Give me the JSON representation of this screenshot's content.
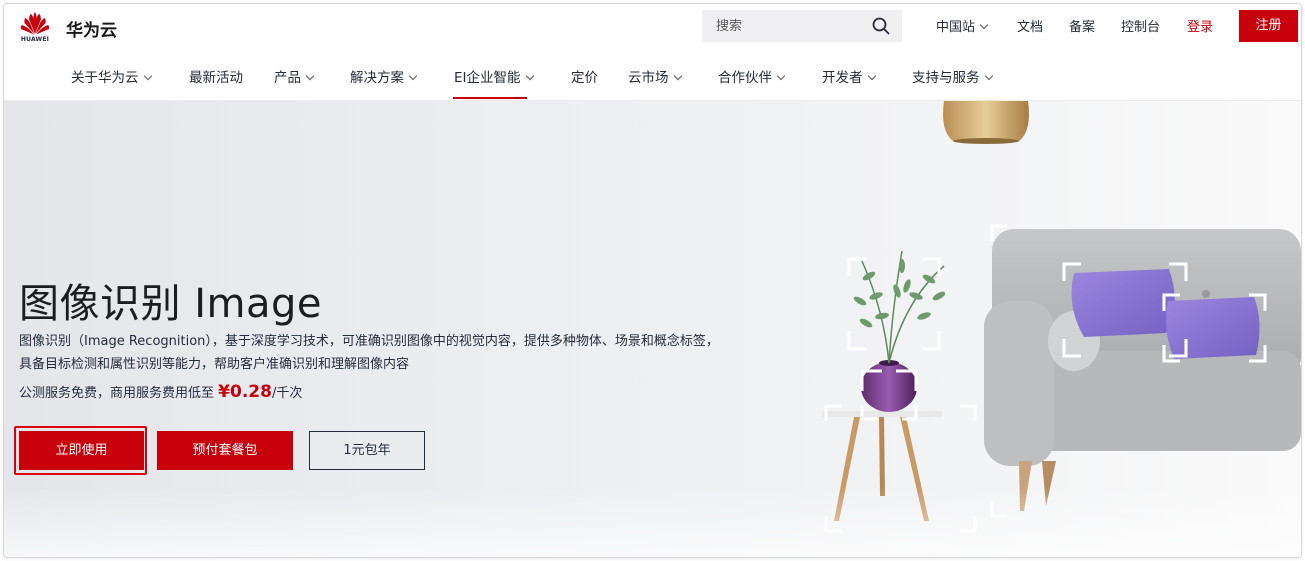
{
  "brand": {
    "logo_text": "HUAWEI",
    "name": "华为云"
  },
  "search": {
    "placeholder": "搜索"
  },
  "top_links": {
    "region": "中国站",
    "docs": "文档",
    "filing": "备案",
    "console": "控制台",
    "login": "登录",
    "register": "注册"
  },
  "nav": [
    {
      "label": "关于华为云",
      "has_menu": true
    },
    {
      "label": "最新活动",
      "has_menu": false
    },
    {
      "label": "产品",
      "has_menu": true
    },
    {
      "label": "解决方案",
      "has_menu": true
    },
    {
      "label": "EI企业智能",
      "has_menu": true,
      "active": true
    },
    {
      "label": "定价",
      "has_menu": false
    },
    {
      "label": "云市场",
      "has_menu": true
    },
    {
      "label": "合作伙伴",
      "has_menu": true
    },
    {
      "label": "开发者",
      "has_menu": true
    },
    {
      "label": "支持与服务",
      "has_menu": true
    }
  ],
  "hero": {
    "title": "图像识别 Image",
    "description_line1": "图像识别（Image Recognition），基于深度学习技术，可准确识别图像中的视觉内容，提供多种物体、场景和概念标签，",
    "description_line2": "具备目标检测和属性识别等能力，帮助客户准确识别和理解图像内容",
    "price_prefix": "公测服务免费，商用服务费用低至",
    "price_amount": "¥0.28",
    "price_suffix": "/千次",
    "buttons": {
      "primary": "立即使用",
      "package": "预付套餐包",
      "yearly": "1元包年"
    }
  },
  "colors": {
    "brand_red": "#c7000b",
    "text": "#252b3a",
    "highlight_outline": "#e0000b"
  }
}
